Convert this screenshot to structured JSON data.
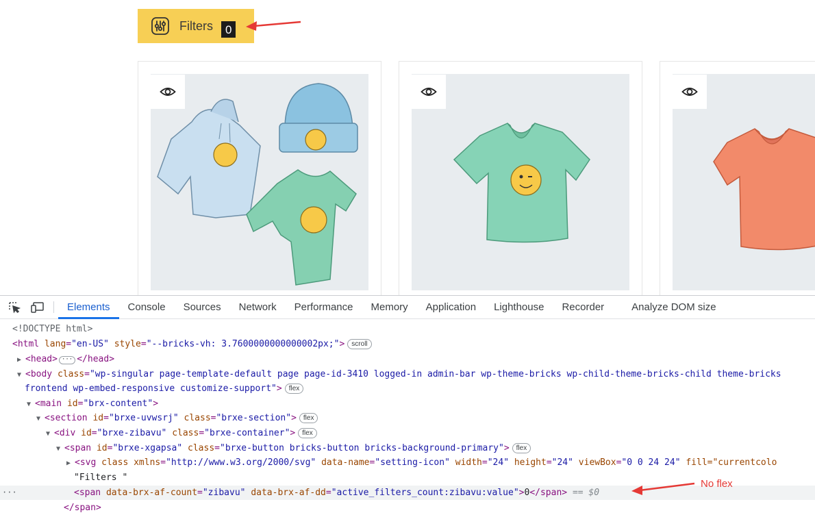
{
  "filters_button": {
    "label": "Filters",
    "count": "0"
  },
  "devtools": {
    "tabs": [
      "Elements",
      "Console",
      "Sources",
      "Network",
      "Performance",
      "Memory",
      "Application",
      "Lighthouse",
      "Recorder",
      "Analyze DOM size"
    ],
    "active_tab": "Elements",
    "dom": {
      "doctype": "<!DOCTYPE html>",
      "html_lang": "\"en-US\"",
      "html_style": "\"--bricks-vh: 3.7600000000000002px;\"",
      "pill_scroll": "scroll",
      "pill_flex": "flex",
      "body_class_line1": "\"wp-singular page-template-default page page-id-3410 logged-in admin-bar wp-theme-bricks wp-child-theme-bricks-child theme-bricks",
      "body_class_line2": "frontend wp-embed-responsive customize-support\"",
      "main_id": "\"brx-content\"",
      "section_id": "\"brxe-uvwsrj\"",
      "section_class": "\"brxe-section\"",
      "div_id": "\"brxe-zibavu\"",
      "div_class": "\"brxe-container\"",
      "span_id": "\"brxe-xgapsa\"",
      "span_class": "\"brxe-button bricks-button bricks-background-primary\"",
      "svg_class_attr": "class",
      "svg_xmlns": "\"http://www.w3.org/2000/svg\"",
      "svg_data_name": "\"setting-icon\"",
      "svg_width": "\"24\"",
      "svg_height": "\"24\"",
      "svg_viewbox": "\"0 0 24 24\"",
      "svg_fill": "fill=\"currentcolo",
      "text_node": "\"Filters \"",
      "count_span_af_count": "\"zibavu\"",
      "count_span_af_dd": "\"active_filters_count:zibavu:value\"",
      "count_span_text": "0",
      "console_ref": "== $0",
      "close_span": "</span>"
    },
    "annotation": "No flex"
  },
  "colors": {
    "filters_bg": "#f7cf55",
    "accent": "#1a73e8",
    "annotation": "#e53935"
  }
}
